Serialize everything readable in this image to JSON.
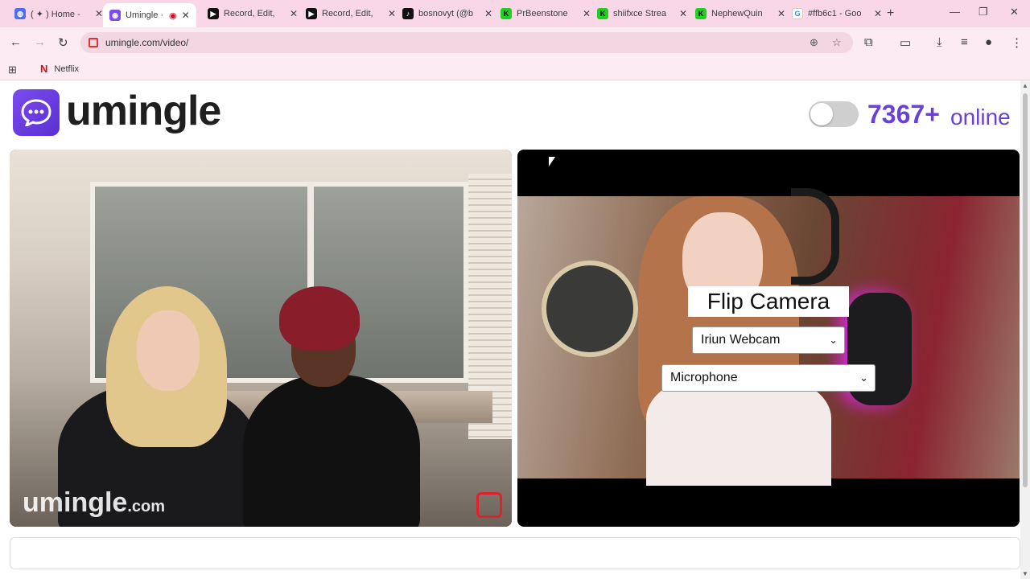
{
  "browser": {
    "tabs": [
      {
        "title": "( ✦ ) Home - ",
        "fav_color": "#4c6ef5",
        "fav_glyph": "◍"
      },
      {
        "title": "Umingle · ",
        "fav_color": "#7b4cf0",
        "fav_glyph": "◉",
        "active": true
      },
      {
        "title": "Record, Edit, ",
        "fav_color": "#111111",
        "fav_glyph": "▶"
      },
      {
        "title": "Record, Edit, ",
        "fav_color": "#111111",
        "fav_glyph": "▶"
      },
      {
        "title": "bosnovyt (@b",
        "fav_color": "#111111",
        "fav_glyph": "♪"
      },
      {
        "title": "PrBeenstone",
        "fav_color": "#1fd11f",
        "fav_glyph": "K"
      },
      {
        "title": "shiifxce Strea",
        "fav_color": "#1fd11f",
        "fav_glyph": "K"
      },
      {
        "title": "NephewQuin",
        "fav_color": "#1fd11f",
        "fav_glyph": "K"
      },
      {
        "title": "#ffb6c1 - Goo",
        "fav_color": "#4285f4",
        "fav_glyph": "G"
      }
    ],
    "url": "umingle.com/video/",
    "bookmarks": [
      {
        "label": "Netflix"
      }
    ]
  },
  "header": {
    "logo_text": "umingle",
    "online_count": "7367+",
    "online_label": "online",
    "toggle_on": false
  },
  "video_left": {
    "watermark_main": "umingle",
    "watermark_domain": ".com"
  },
  "video_right": {
    "flip_camera_label": "Flip Camera",
    "camera_select_value": "Iriun Webcam",
    "microphone_select_value": "Microphone"
  },
  "colors": {
    "accent": "#6741d9",
    "tabstrip": "#f9d7e6"
  }
}
